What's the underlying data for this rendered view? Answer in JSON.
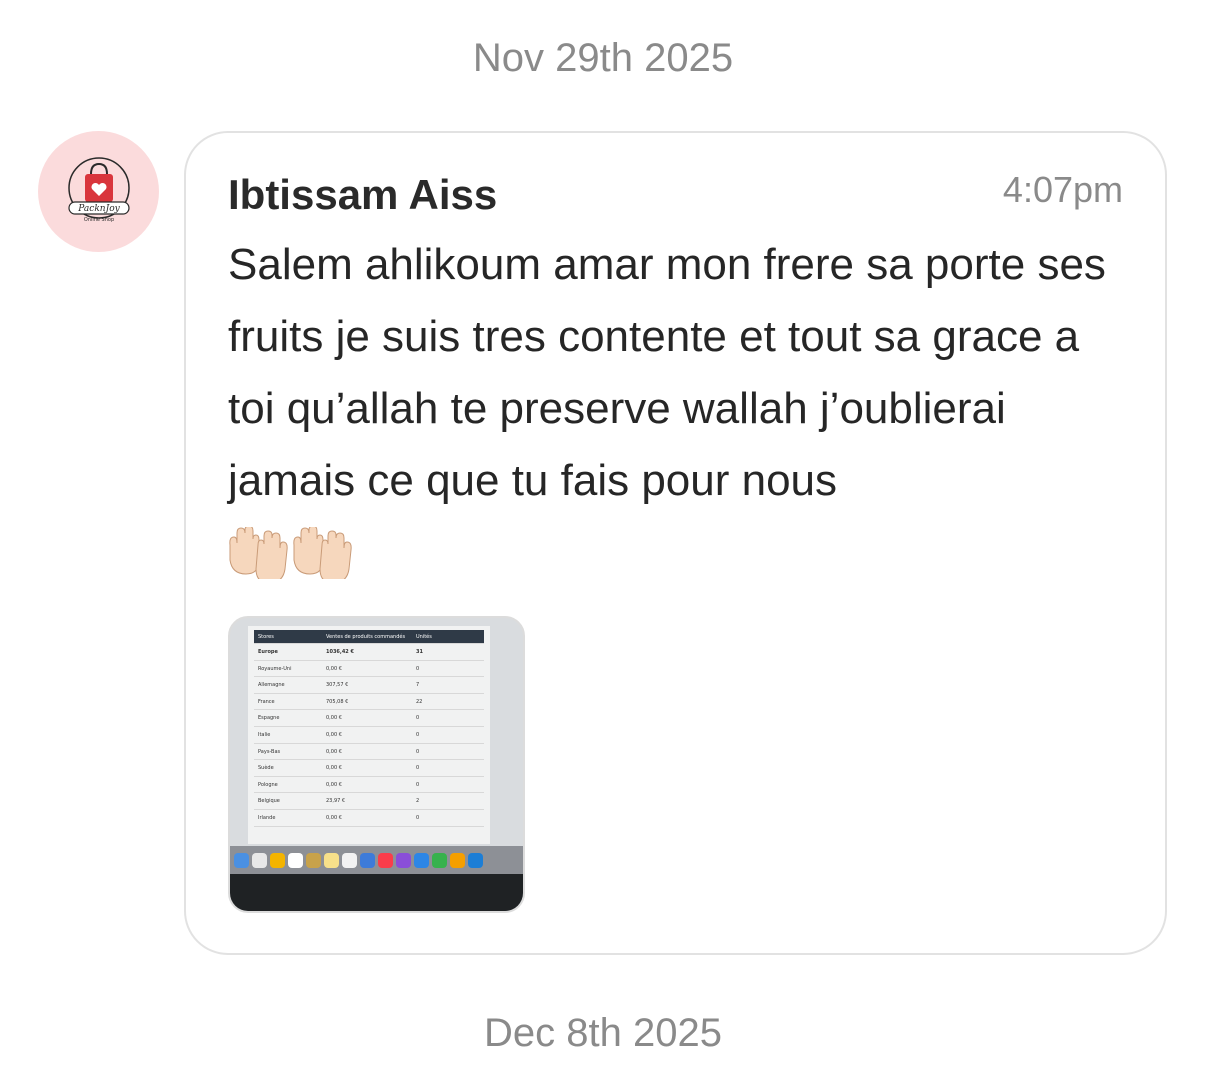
{
  "dates": {
    "top": "Nov 29th 2025",
    "bottom": "Dec 8th 2025"
  },
  "message": {
    "sender": "Ibtissam Aiss",
    "time": "4:07pm",
    "text": "Salem ahlikoum amar mon frere sa porte ses fruits je suis tres contente et tout sa grace a toi qu’allah te preserve wallah j’oublierai jamais ce que tu fais pour nous",
    "emojis": [
      "palms-up-together",
      "palms-up-together"
    ]
  },
  "avatar": {
    "brand": "PacknJoy",
    "tagline": "Online Shop"
  },
  "attachment": {
    "header": [
      "Stores",
      "Ventes de produits commandés",
      "Unités"
    ],
    "rows": [
      [
        "Europe",
        "1036,42 €",
        "31"
      ],
      [
        "Royaume-Uni",
        "0,00 €",
        "0"
      ],
      [
        "Allemagne",
        "307,57 €",
        "7"
      ],
      [
        "France",
        "705,08 €",
        "22"
      ],
      [
        "Espagne",
        "0,00 €",
        "0"
      ],
      [
        "Italie",
        "0,00 €",
        "0"
      ],
      [
        "Pays-Bas",
        "0,00 €",
        "0"
      ],
      [
        "Suède",
        "0,00 €",
        "0"
      ],
      [
        "Pologne",
        "0,00 €",
        "0"
      ],
      [
        "Belgique",
        "23,97 €",
        "2"
      ],
      [
        "Irlande",
        "0,00 €",
        "0"
      ]
    ]
  },
  "colors": {
    "avatar_bg": "#fbdbdc",
    "brand_red": "#d9353c",
    "date_gray": "#8a8a8a"
  }
}
